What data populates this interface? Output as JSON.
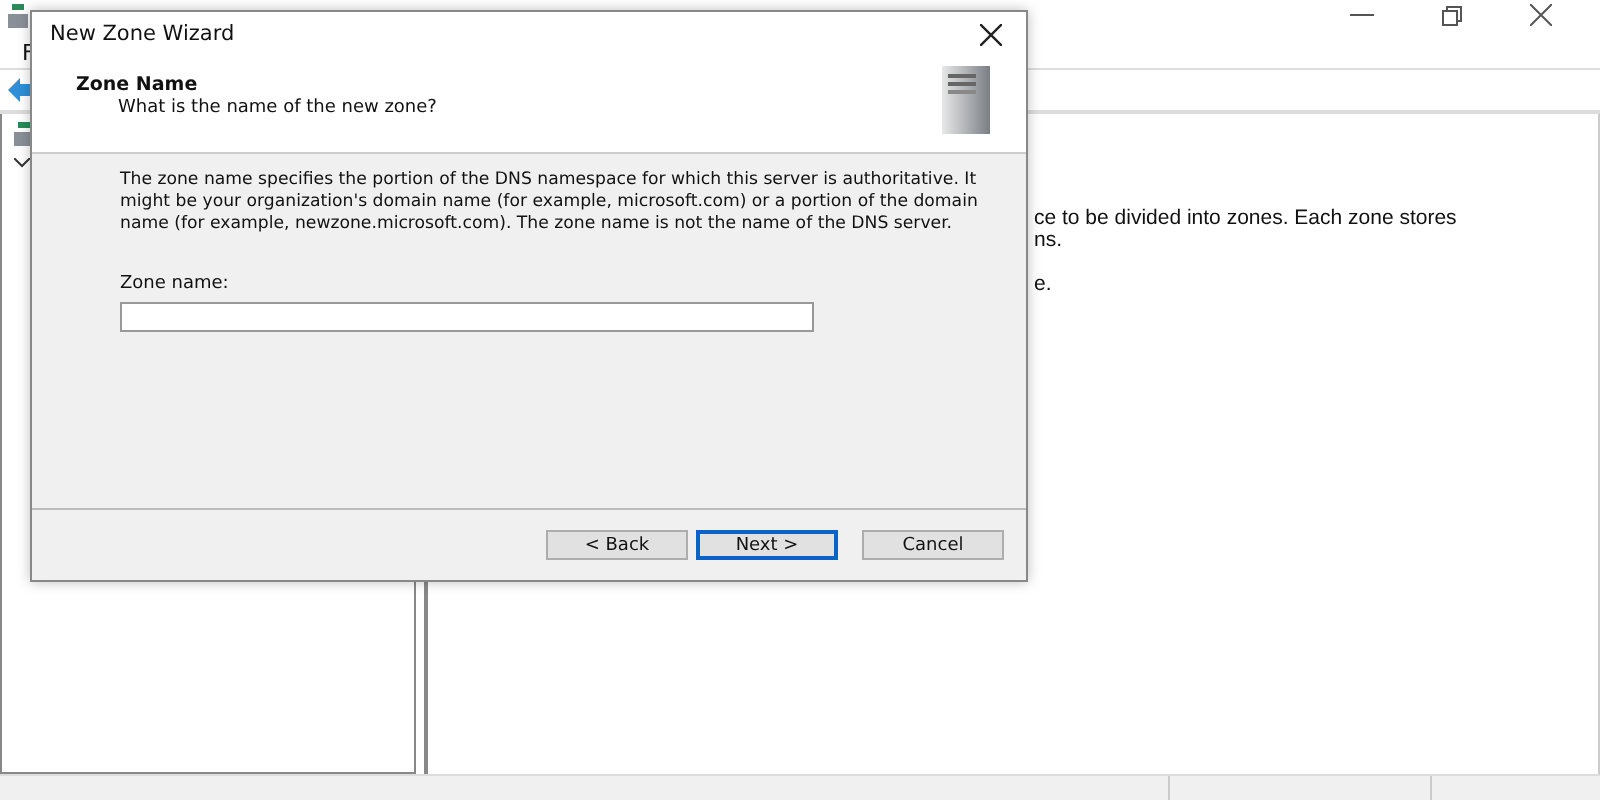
{
  "main_window": {
    "menu": [
      "F"
    ],
    "details": [
      "ce to be divided into zones. Each zone stores",
      "ns.",
      "e."
    ]
  },
  "dialog": {
    "title": "New Zone Wizard",
    "heading": "Zone Name",
    "subheading": "What is the name of the new zone?",
    "description": "The zone name specifies the portion of the DNS namespace for which this server is authoritative. It might be your organization's domain name (for example,  microsoft.com) or a portion of the domain name (for example, newzone.microsoft.com). The zone name is not the name of the DNS server.",
    "field_label": "Zone name:",
    "buttons": [
      {
        "label": "< Back",
        "default": false
      },
      {
        "label": "Next >",
        "default": true
      },
      {
        "label": "Cancel",
        "default": false
      }
    ]
  }
}
